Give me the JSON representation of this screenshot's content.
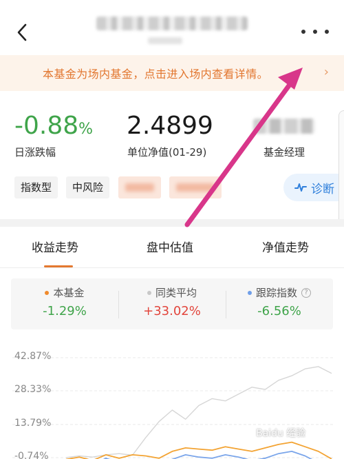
{
  "notice": {
    "text": "本基金为场内基金，点击进入场内查看详情。",
    "chevron": "›"
  },
  "stats": {
    "daily_change_value": "-0.88",
    "daily_change_unit": "%",
    "daily_change_label": "日涨跌幅",
    "nav_value": "2.4899",
    "nav_label": "单位净值(01-29)",
    "manager_label": "基金经理"
  },
  "tags": [
    "指数型",
    "中风险"
  ],
  "diagnose_label": "诊断",
  "tabs": [
    "收益走势",
    "盘中估值",
    "净值走势"
  ],
  "legend": [
    {
      "name": "本基金",
      "value": "-1.29%",
      "dot_color": "#f08a2c",
      "value_color": "#3fa44a"
    },
    {
      "name": "同类平均",
      "value": "+33.02%",
      "dot_color": "#c8c8c8",
      "value_color": "#e2453c"
    },
    {
      "name": "跟踪指数",
      "value": "-6.56%",
      "dot_color": "#6f9ee8",
      "value_color": "#3fa44a"
    }
  ],
  "chart_data": {
    "type": "line",
    "y_ticks": [
      "42.87%",
      "28.33%",
      "13.79%",
      "-0.74%"
    ],
    "ylim": [
      -0.74,
      42.87
    ],
    "grid": true,
    "series": [
      {
        "values": [
          -0.7,
          0.0,
          -0.5,
          0.5,
          1.0,
          0.3,
          8.0,
          15.0,
          20.0,
          16.0,
          22.0,
          25.0,
          24.0,
          27.0,
          30.0,
          29.0,
          33.0,
          35.0,
          38.0,
          39.0,
          36.0
        ],
        "color": "#d6d6d6"
      },
      {
        "values": [
          -1.5,
          -0.5,
          -2.0,
          0.5,
          -1.0,
          0.5,
          0.0,
          -1.0,
          2.0,
          3.5,
          3.0,
          2.5,
          4.0,
          3.0,
          2.0,
          3.5,
          5.0,
          6.0,
          4.0,
          2.0,
          -1.3
        ],
        "color": "#f3a332"
      },
      {
        "values": [
          -3.0,
          -2.0,
          -4.0,
          -1.0,
          -3.0,
          -2.5,
          -3.0,
          -4.0,
          -1.5,
          0.5,
          -0.5,
          -1.0,
          0.5,
          -0.5,
          -2.0,
          -1.0,
          1.0,
          2.0,
          0.0,
          -3.0,
          -6.6
        ],
        "color": "#7aa5ea"
      }
    ]
  },
  "watermark": "Baidu 经验",
  "colors": {
    "accent": "#e4782f",
    "up": "#e2453c",
    "down": "#3fa44a",
    "arrow": "#d8368a"
  }
}
